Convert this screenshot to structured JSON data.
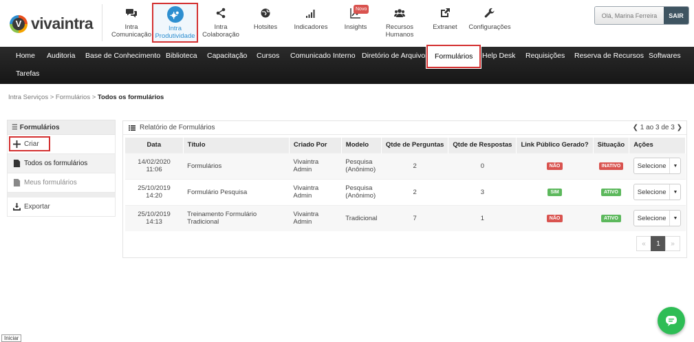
{
  "brand": {
    "name": "vivaintra",
    "mark": "V"
  },
  "apps": [
    {
      "label": "Intra Comunicação",
      "icon": "chat-bubbles-icon"
    },
    {
      "label": "Intra Produtividade",
      "icon": "gears-icon",
      "active": true
    },
    {
      "label": "Intra Colaboração",
      "icon": "share-icon"
    },
    {
      "label": "Hotsites",
      "icon": "globe-icon"
    },
    {
      "label": "Indicadores",
      "icon": "signal-bars-icon"
    },
    {
      "label": "Insights",
      "icon": "line-chart-icon",
      "badge": "Novo"
    },
    {
      "label": "Recursos Humanos",
      "icon": "users-icon"
    },
    {
      "label": "Extranet",
      "icon": "external-link-icon"
    },
    {
      "label": "Configurações",
      "icon": "wrench-icon"
    }
  ],
  "user": {
    "greeting": "Olá, Marina Ferreira",
    "logout": "SAIR"
  },
  "nav": [
    "Home",
    "Auditoria",
    "Base de Conhecimento",
    "Biblioteca",
    "Capacitação",
    "Cursos",
    "Comunicado Interno",
    "Diretório de Arquivos",
    "Formulários",
    "Help Desk",
    "Requisições",
    "Reserva de Recursos",
    "Softwares",
    "Tarefas"
  ],
  "nav_active": "Formulários",
  "breadcrumb": {
    "items": [
      "Intra Serviços",
      "Formulários"
    ],
    "current": "Todos os formulários",
    "sep": ">"
  },
  "sidebar": {
    "title": "Formulários",
    "create": "Criar",
    "all": "Todos os formulários",
    "mine": "Meus formulários",
    "export": "Exportar"
  },
  "report": {
    "title": "Relatório de Formulários",
    "pager": "1 ao 3 de 3",
    "columns": [
      "Data",
      "Título",
      "Criado Por",
      "Modelo",
      "Qtde de Perguntas",
      "Qtde de Respostas",
      "Link Público Gerado?",
      "Situação",
      "Ações"
    ],
    "rows": [
      {
        "date": "14/02/2020 11:06",
        "title": "Formulários",
        "author": "Vivaintra Admin",
        "model": "Pesquisa (Anônimo)",
        "questions": "2",
        "answers": "0",
        "public_link": "NÃO",
        "status": "INATIVO",
        "action": "Selecione"
      },
      {
        "date": "25/10/2019 14:20",
        "title": "Formulário Pesquisa",
        "author": "Vivaintra Admin",
        "model": "Pesquisa (Anônimo)",
        "questions": "2",
        "answers": "3",
        "public_link": "SIM",
        "status": "ATIVO",
        "action": "Selecione"
      },
      {
        "date": "25/10/2019 14:13",
        "title": "Treinamento Formulário Tradicional",
        "author": "Vivaintra Admin",
        "model": "Tradicional",
        "questions": "7",
        "answers": "1",
        "public_link": "NÃO",
        "status": "ATIVO",
        "action": "Selecione"
      }
    ],
    "pagination": {
      "prev": "«",
      "current": "1",
      "next": "»"
    }
  },
  "taskbar": {
    "start": "Iniciar"
  },
  "colors": {
    "accent": "#2e8fd0",
    "highlight_border": "#d32f2f",
    "badge_red": "#d9534f",
    "badge_green": "#5cb85c",
    "chat": "#2ebd55"
  }
}
